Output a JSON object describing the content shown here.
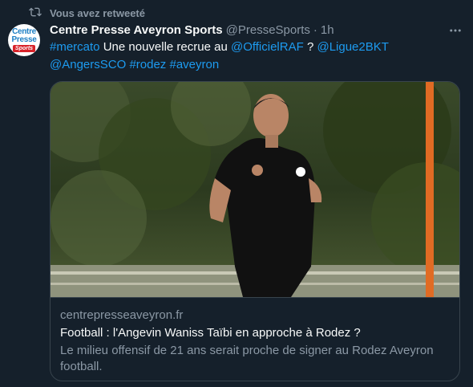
{
  "retweet": {
    "label": "Vous avez retweeté"
  },
  "avatar": {
    "line1": "Centre",
    "line2": "Presse",
    "line3": "Sports"
  },
  "tweet": {
    "author_name": "Centre Presse Aveyron Sports",
    "handle": "@PresseSports",
    "separator": "·",
    "time": "1h",
    "text_parts": {
      "hashtag_mercato": "#mercato",
      "text1": " Une nouvelle recrue au ",
      "mention_raf": "@OfficielRAF",
      "text2": " ? ",
      "mention_ligue": "@Ligue2BKT",
      "mention_sco": "@AngersSCO",
      "hashtag_rodez": "#rodez",
      "hashtag_aveyron": "#aveyron"
    }
  },
  "card": {
    "domain": "centrepresseaveyron.fr",
    "title": "Football : l'Angevin Waniss Taïbi en approche à Rodez ?",
    "description": "Le milieu offensif de 21 ans serait proche de signer au Rodez Aveyron football."
  },
  "colors": {
    "background": "#15202b",
    "link": "#1d9bf0",
    "muted": "#8b98a5",
    "border": "#38444d"
  },
  "icons": {
    "retweet": "retweet-icon",
    "more": "more-icon"
  }
}
